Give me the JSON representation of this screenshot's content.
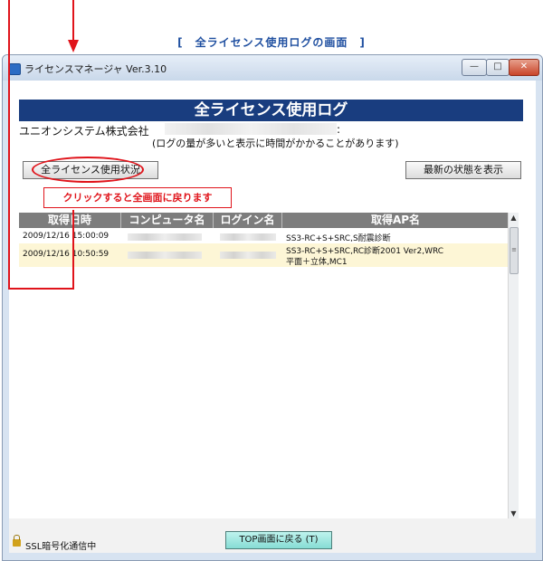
{
  "caption": "[　全ライセンス使用ログの画面　]",
  "window": {
    "title": "ライセンスマネージャ Ver.3.10",
    "controls": {
      "minimize": "—",
      "maximize": "□",
      "close": "✕"
    }
  },
  "page": {
    "header": "全ライセンス使用ログ",
    "company": "ユニオンシステム株式会社",
    "colon": ":",
    "note": "(ログの量が多いと表示に時間がかかることがあります)",
    "btn_all_usage": "全ライセンス使用状況",
    "btn_latest": "最新の状態を表示",
    "tip": "クリックすると全画面に戻ります"
  },
  "table": {
    "columns": [
      "取得日時",
      "コンピュータ名",
      "ログイン名",
      "取得AP名"
    ],
    "rows": [
      {
        "datetime": "2009/12/16 15:00:09",
        "computer": "",
        "login": "",
        "ap": [
          "SS3-RC+S+SRC,S耐震診断"
        ]
      },
      {
        "datetime": "2009/12/16 10:50:59",
        "computer": "",
        "login": "",
        "ap": [
          "SS3-RC+S+SRC,RC診断2001 Ver2,WRC",
          "平面＋立体,MC1"
        ]
      }
    ]
  },
  "footer": {
    "ssl": "SSL暗号化通信中",
    "top_button": "TOP画面に戻る (T)"
  },
  "colors": {
    "header_bg": "#193d7f",
    "annotation": "#e0141b",
    "row_highlight": "#fdf6d6",
    "top_button": "#86dcd4"
  }
}
